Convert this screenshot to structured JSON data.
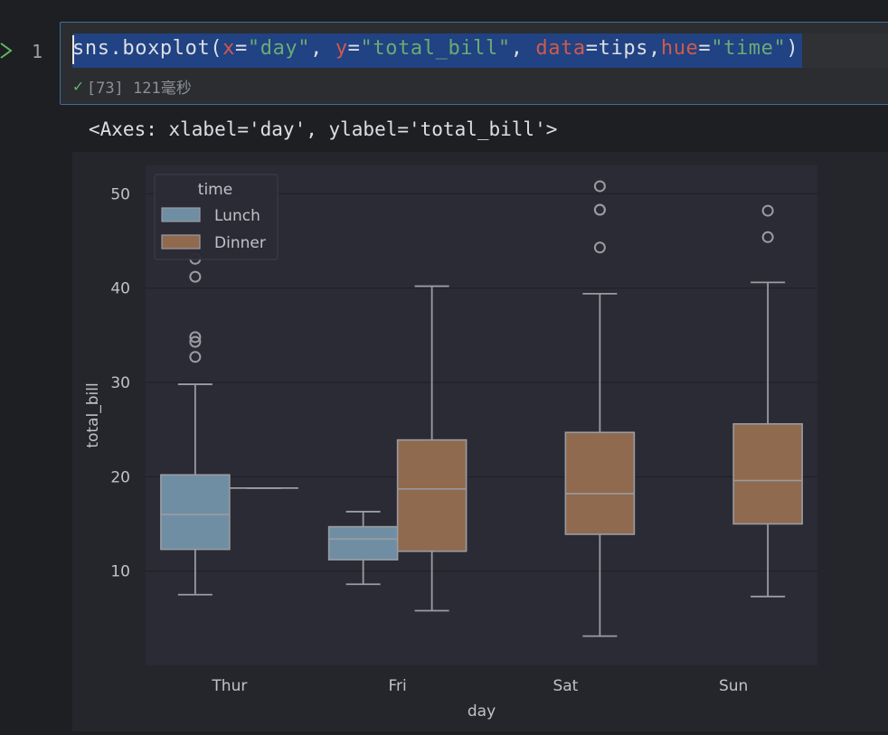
{
  "cell": {
    "line_number": "1",
    "code_tokens": [
      {
        "text": "sns.boxplot(",
        "cls": ""
      },
      {
        "text": "x",
        "cls": "kw-param"
      },
      {
        "text": "=",
        "cls": ""
      },
      {
        "text": "\"day\"",
        "cls": "kw-str"
      },
      {
        "text": ", ",
        "cls": ""
      },
      {
        "text": "y",
        "cls": "kw-param"
      },
      {
        "text": "=",
        "cls": ""
      },
      {
        "text": "\"total_bill\"",
        "cls": "kw-str"
      },
      {
        "text": ", ",
        "cls": ""
      },
      {
        "text": "data",
        "cls": "kw-param"
      },
      {
        "text": "=tips,",
        "cls": ""
      },
      {
        "text": "hue",
        "cls": "kw-param"
      },
      {
        "text": "=",
        "cls": ""
      },
      {
        "text": "\"time\"",
        "cls": "kw-str"
      },
      {
        "text": ")",
        "cls": ""
      }
    ],
    "status_check": "✓",
    "status_text": "[73] 121毫秒"
  },
  "output": {
    "repr": "<Axes: xlabel='day', ylabel='total_bill'>"
  },
  "colors": {
    "lunch": "#6f8ea3",
    "dinner": "#8f6a4e",
    "axes_bg": "#2a2b35",
    "grid": "#1e1f24",
    "line": "#9a9ca3",
    "text": "#c0c2c8"
  },
  "chart_data": {
    "type": "boxplot",
    "xlabel": "day",
    "ylabel": "total_bill",
    "ylim": [
      0,
      53
    ],
    "yticks": [
      10,
      20,
      30,
      40,
      50
    ],
    "categories": [
      "Thur",
      "Fri",
      "Sat",
      "Sun"
    ],
    "legend": {
      "title": "time",
      "placement": "top-left",
      "entries": [
        "Lunch",
        "Dinner"
      ]
    },
    "grid": true,
    "series": [
      {
        "name": "Lunch",
        "boxes": [
          {
            "category": "Thur",
            "whisker_low": 7.5,
            "q1": 12.3,
            "median": 16.0,
            "q3": 20.2,
            "whisker_high": 29.8,
            "outliers": [
              32.7,
              34.3,
              34.8,
              41.2,
              43.1
            ]
          },
          {
            "category": "Fri",
            "whisker_low": 8.6,
            "q1": 11.2,
            "median": 13.4,
            "q3": 14.7,
            "whisker_high": 16.3,
            "outliers": []
          }
        ]
      },
      {
        "name": "Dinner",
        "boxes": [
          {
            "category": "Thur",
            "whisker_low": 18.8,
            "q1": 18.8,
            "median": 18.8,
            "q3": 18.8,
            "whisker_high": 18.8,
            "outliers": []
          },
          {
            "category": "Fri",
            "whisker_low": 5.8,
            "q1": 12.1,
            "median": 18.7,
            "q3": 23.9,
            "whisker_high": 40.2,
            "outliers": []
          },
          {
            "category": "Sat",
            "whisker_low": 3.1,
            "q1": 13.9,
            "median": 18.2,
            "q3": 24.7,
            "whisker_high": 39.4,
            "outliers": [
              44.3,
              48.3,
              48.3,
              50.8
            ]
          },
          {
            "category": "Sun",
            "whisker_low": 7.3,
            "q1": 15.0,
            "median": 19.6,
            "q3": 25.6,
            "whisker_high": 40.6,
            "outliers": [
              45.4,
              48.2
            ]
          }
        ]
      }
    ]
  }
}
